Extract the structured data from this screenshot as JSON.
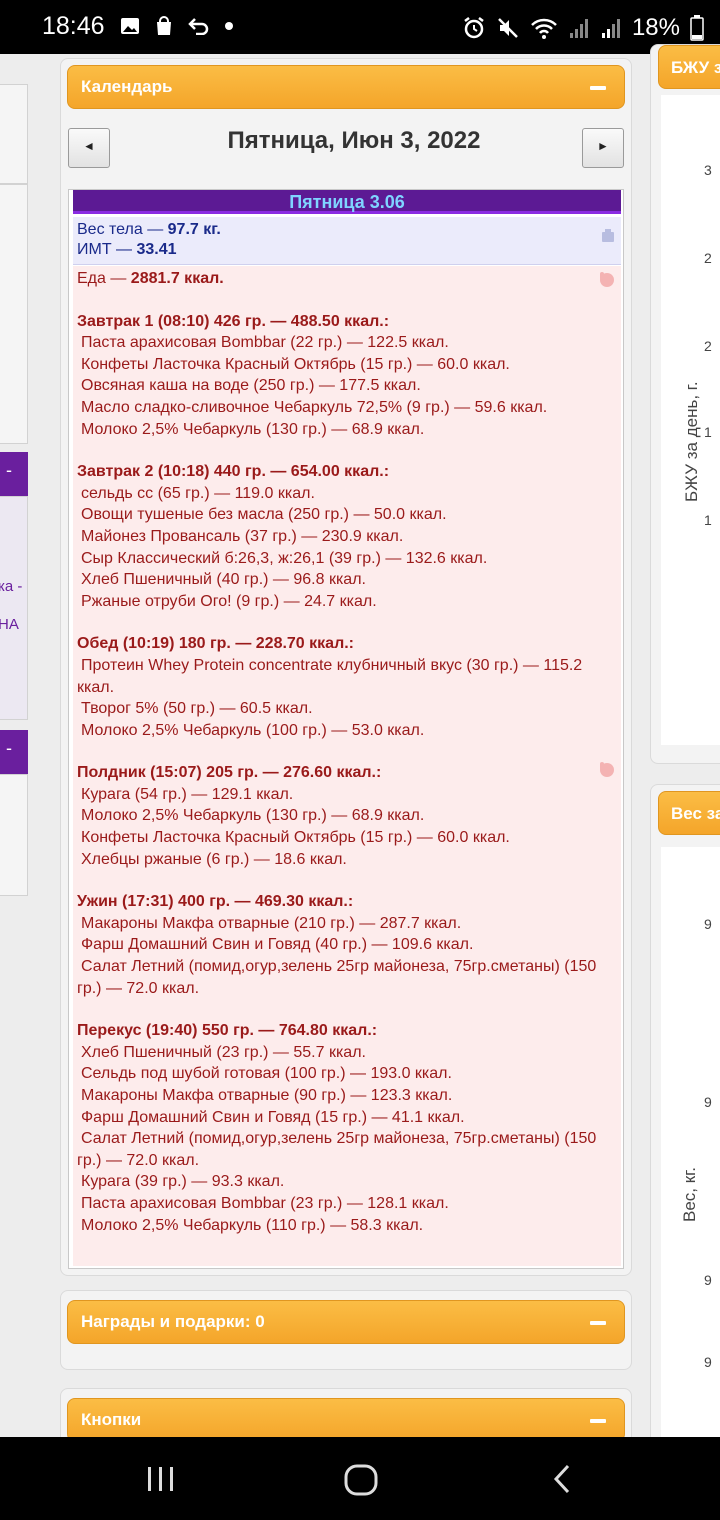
{
  "status_bar": {
    "time": "18:46",
    "battery": "18%"
  },
  "calendar": {
    "title": "Календарь",
    "prev_label": "◄",
    "next_label": "►",
    "date": "Пятница, Июн 3, 2022",
    "day_header": "Пятница 3.06",
    "weight_label": "Вес тела — ",
    "weight_value": "97.7 кг.",
    "bmi_label": "ИМТ — ",
    "bmi_value": "33.41",
    "food_label": "Еда — ",
    "food_value": "2881.7 ккал.",
    "meals": [
      {
        "title": "Завтрак 1 (08:10) 426 гр. — 488.50 ккал.:",
        "items": [
          "Паста арахисовая Bombbar (22 гр.) — 122.5 ккал.",
          "Конфеты Ласточка Красный Октябрь (15 гр.) — 60.0 ккал.",
          "Овсяная каша на воде (250 гр.) — 177.5 ккал.",
          "Масло сладко-сливочное Чебаркуль 72,5% (9 гр.) — 59.6 ккал.",
          "Молоко 2,5% Чебаркуль (130 гр.) — 68.9 ккал."
        ]
      },
      {
        "title": "Завтрак 2 (10:18) 440 гр. — 654.00 ккал.:",
        "items": [
          "сельдь сс (65 гр.) — 119.0 ккал.",
          "Овощи тушеные без масла (250 гр.) — 50.0 ккал.",
          "Майонез Провансаль (37 гр.) — 230.9 ккал.",
          "Сыр Классический б:26,3, ж:26,1 (39 гр.) — 132.6 ккал.",
          "Хлеб Пшеничный (40 гр.) — 96.8 ккал.",
          "Ржаные отруби Ого! (9 гр.) — 24.7 ккал."
        ]
      },
      {
        "title": "Обед (10:19) 180 гр. — 228.70 ккал.:",
        "items": [
          "Протеин Whey Protein concentrate клубничный вкус (30 гр.) — 115.2 ккал.",
          "Творог 5% (50 гр.) — 60.5 ккал.",
          "Молоко 2,5% Чебаркуль (100 гр.) — 53.0 ккал."
        ]
      },
      {
        "title": "Полдник (15:07) 205 гр. — 276.60 ккал.:",
        "items": [
          "Курага (54 гр.) — 129.1 ккал.",
          "Молоко 2,5% Чебаркуль (130 гр.) — 68.9 ккал.",
          "Конфеты Ласточка Красный Октябрь (15 гр.) — 60.0 ккал.",
          "Хлебцы ржаные (6 гр.) — 18.6 ккал."
        ]
      },
      {
        "title": "Ужин (17:31) 400 гр. — 469.30 ккал.:",
        "items": [
          "Макароны Макфа отварные (210 гр.) — 287.7 ккал.",
          "Фарш Домашний Свин и Говяд (40 гр.) — 109.6 ккал.",
          "Салат Летний (помид,огур,зелень 25гр майонеза, 75гр.сметаны) (150 гр.) — 72.0 ккал."
        ]
      },
      {
        "title": "Перекус (19:40) 550 гр. — 764.80 ккал.:",
        "items": [
          "Хлеб Пшеничный (23 гр.) — 55.7 ккал.",
          "Сельдь под шубой готовая (100 гр.) — 193.0 ккал.",
          "Макароны Макфа отварные (90 гр.) — 123.3 ккал.",
          "Фарш Домашний Свин и Говяд (15 гр.) — 41.1 ккал.",
          "Салат Летний (помид,огур,зелень 25гр майонеза, 75гр.сметаны) (150 гр.) — 72.0 ккал.",
          "Курага (39 гр.) — 93.3 ккал.",
          "Паста арахисовая Bombbar (23 гр.) — 128.1 ккал.",
          "Молоко 2,5% Чебаркуль (110 гр.) — 58.3 ккал."
        ]
      }
    ]
  },
  "rewards": {
    "title": "Награды и подарки: 0"
  },
  "buttons_panel": {
    "title": "Кнопки"
  },
  "right_panels": {
    "bju_header": "БЖУ з",
    "bju_axis": "БЖУ за день, г.",
    "bju_ticks": [
      "3",
      "2",
      "2",
      "1",
      "1"
    ],
    "weight_header": "Вес за",
    "weight_axis": "Вес, кг.",
    "weight_ticks": [
      "9",
      "9",
      "9",
      "9"
    ]
  },
  "left_panels": {
    "text1": "ка -",
    "text2": "НА"
  }
}
